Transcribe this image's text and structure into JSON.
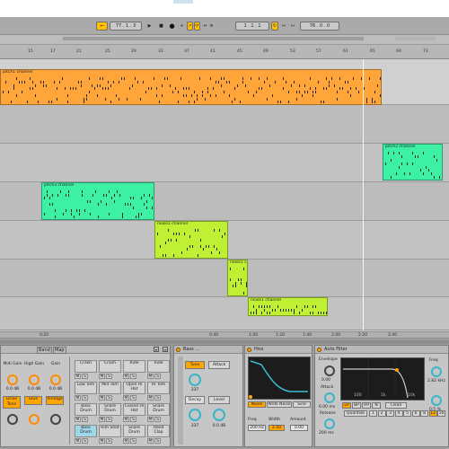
{
  "transport": {
    "tempo": "77 . 1 . 3",
    "position": "1 . 1 . 1",
    "quant": "76 . 0 . 0"
  },
  "ruler": {
    "bars": [
      "15",
      "17",
      "21",
      "25",
      "29",
      "33",
      "37",
      "41",
      "45",
      "49",
      "53",
      "57",
      "61",
      "65",
      "69",
      "73"
    ],
    "time": [
      "0:20",
      "0:40",
      "1:00",
      "1:20",
      "1:40",
      "2:00",
      "2:20",
      "2:40"
    ]
  },
  "colors": {
    "orange": "#ffa53a",
    "mint": "#3ef0a4",
    "lime": "#bff034",
    "grey": "#c8c8c8"
  },
  "clips": [
    {
      "name": "pitch1 channel",
      "color": "orange"
    },
    {
      "name": "pitch2 channel",
      "color": "mint"
    },
    {
      "name": "pitch3 channel",
      "color": "mint"
    },
    {
      "name": "noise1 channel",
      "color": "lime"
    },
    {
      "name": "noise1 c",
      "color": "lime"
    },
    {
      "name": "noise1 channel",
      "color": "lime"
    }
  ],
  "drumrack": {
    "header_tabs": [
      "Band",
      "Map"
    ],
    "macros": [
      {
        "label": "Midi Gain",
        "value": "0.0 dB"
      },
      {
        "label": "High Gain",
        "value": "0.0 dB"
      },
      {
        "label": "Gain",
        "value": "0.0 dB"
      }
    ],
    "toggles": [
      "Drive Tone",
      "Glue",
      "Vintage"
    ],
    "pads": [
      [
        "Crash",
        "Crash",
        "Ride",
        "Ride"
      ],
      [
        "Low Tom",
        "Mid Tom",
        "Open Hi Hat",
        "Hi Tom"
      ],
      [
        "Bass Drum",
        "Snare Drum",
        "Closed Hi Hat",
        "Snare Drum"
      ],
      [
        "Bass Drum",
        "Rim Shot",
        "Snare Drum",
        "Hand Clap"
      ]
    ],
    "mute": "M",
    "solo": "S"
  },
  "bass": {
    "title": "Bass ...",
    "tabs": [
      "Tune",
      "Attack"
    ],
    "tune": "337",
    "decay_label": "Decay",
    "level_label": "Level",
    "decay": "337",
    "level": "0.0 dB"
  },
  "filter1": {
    "title": "Hiss",
    "buttons": [
      "Noise",
      "Wide Noise",
      "Sine"
    ],
    "freq_label": "Freq",
    "width_label": "Width",
    "amount_label": "Amount",
    "freq": "200 Hz",
    "width": "2.50",
    "amount": "0.00"
  },
  "autofilter": {
    "title": "Auto Filter",
    "env_label": "Envelope",
    "attack_label": "Attack",
    "attack": "6.00 ms",
    "release_label": "Release",
    "release": "200 ms",
    "freq_label": "Freq",
    "freq": "2.82 kHz",
    "res": "0.5 %",
    "quantize": "Quantize",
    "clean": "Clean",
    "marks": [
      "100",
      "1k",
      "10k"
    ],
    "steps": [
      "1",
      "2",
      "3",
      "4",
      "5",
      "6",
      "8",
      "12",
      "16"
    ]
  }
}
